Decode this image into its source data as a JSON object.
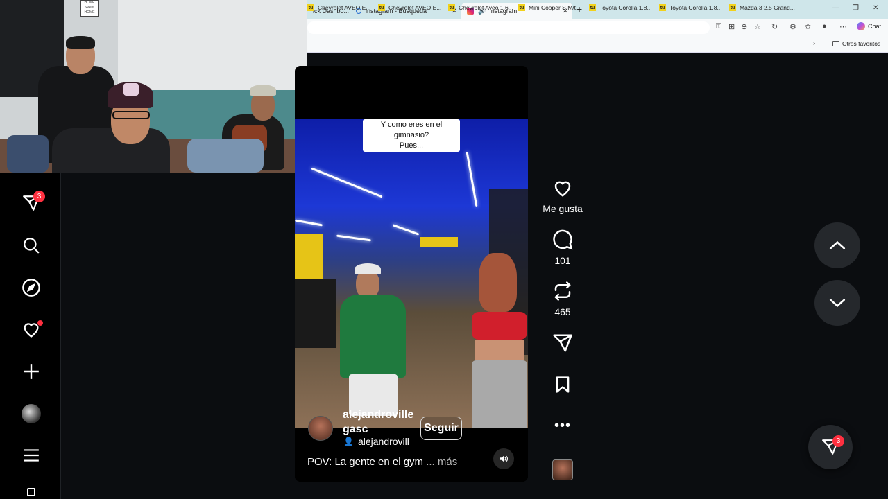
{
  "browser": {
    "tabs": [
      {
        "label": "ick Dashbo..."
      },
      {
        "label": "instagram - Búsqueda"
      },
      {
        "label": "Instagram"
      }
    ],
    "new_tab": "+",
    "chat_label": "Chat",
    "bookmarks": [
      "Chevrolet AVEO E...",
      "Chevrolet AVEO E...",
      "Chevrolet Aveo 1.6...",
      "Mini Cooper S M/t...",
      "Toyota Corolla 1.8...",
      "Toyota Corolla 1.8...",
      "Mazda 3 2.5 Grand..."
    ],
    "bookmark_icon_text": "tu",
    "other_bookmarks": "Otros favoritos"
  },
  "webcam": {
    "sign_text": "HOME Sweet HOME"
  },
  "sidebar": {
    "messages_badge": "3",
    "items": [
      {
        "icon": "send-icon"
      },
      {
        "icon": "search-icon"
      },
      {
        "icon": "compass-icon"
      },
      {
        "icon": "heart-icon"
      },
      {
        "icon": "plus-icon"
      },
      {
        "icon": "profile-avatar"
      },
      {
        "icon": "menu-icon"
      }
    ]
  },
  "reel": {
    "overlay_text_line1": "Y como eres en el gimnasio?",
    "overlay_text_line2": "Pues...",
    "username": "alejandrovillegasc",
    "follow_label": "Seguir",
    "audio_label": "alejandrovill",
    "description": "POV: La gente en el gym",
    "more_label": "... más"
  },
  "actions": {
    "like_label": "Me gusta",
    "comments_count": "101",
    "reposts_count": "465"
  },
  "fab": {
    "messages_badge": "3"
  },
  "colors": {
    "background": "#0b0d10",
    "badge": "#ff3040",
    "tabstrip": "#cfe6ea"
  }
}
